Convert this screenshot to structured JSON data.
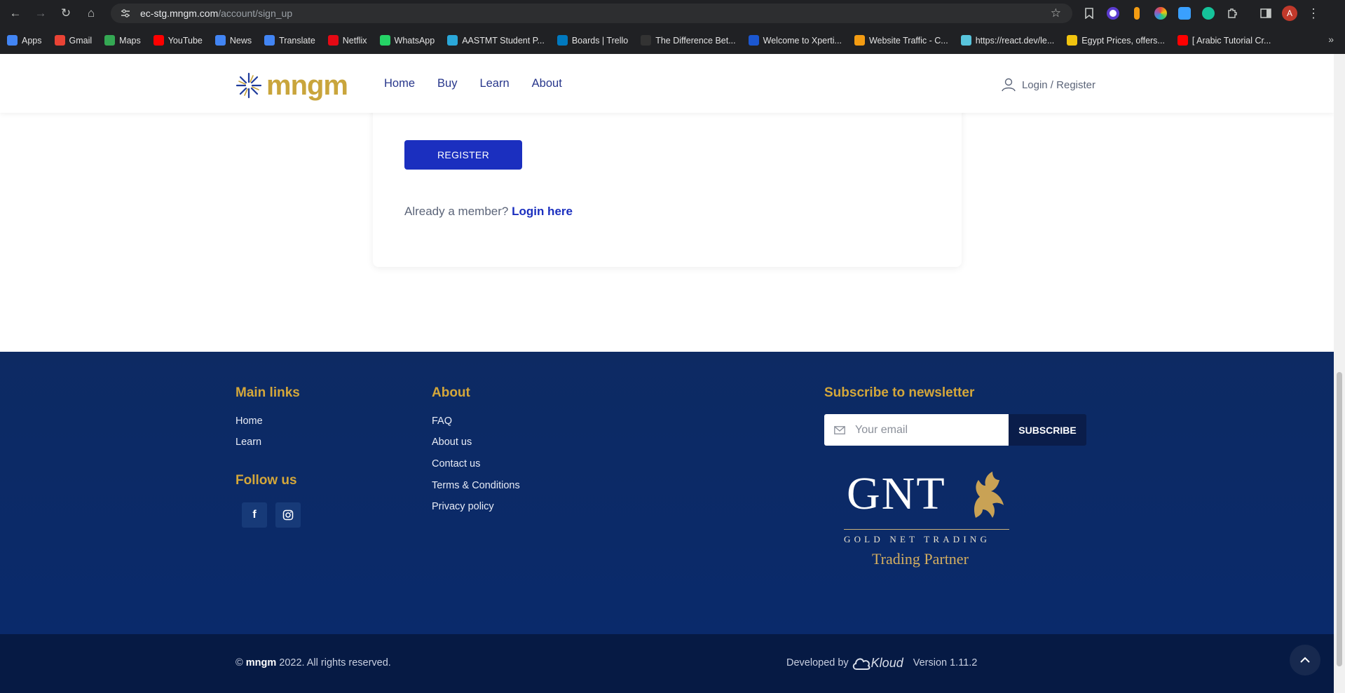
{
  "browser": {
    "url_host": "ec-stg.mngm.com",
    "url_path": "/account/sign_up",
    "profile_initial": "A",
    "bookmarks": [
      {
        "label": "Apps",
        "icon": "apps-grid-icon",
        "color": "#4285f4"
      },
      {
        "label": "Gmail",
        "icon": "gmail-icon",
        "color": "#ea4335"
      },
      {
        "label": "Maps",
        "icon": "maps-icon",
        "color": "#34a853"
      },
      {
        "label": "YouTube",
        "icon": "youtube-icon",
        "color": "#ff0000"
      },
      {
        "label": "News",
        "icon": "news-icon",
        "color": "#4285f4"
      },
      {
        "label": "Translate",
        "icon": "translate-icon",
        "color": "#4285f4"
      },
      {
        "label": "Netflix",
        "icon": "netflix-icon",
        "color": "#e50914"
      },
      {
        "label": "WhatsApp",
        "icon": "whatsapp-icon",
        "color": "#25d366"
      },
      {
        "label": "AASTMT Student P...",
        "icon": "aastmt-icon",
        "color": "#2aa7d9"
      },
      {
        "label": "Boards | Trello",
        "icon": "trello-icon",
        "color": "#0079bf"
      },
      {
        "label": "The Difference Bet...",
        "icon": "dev-icon",
        "color": "#333333"
      },
      {
        "label": "Welcome to Xperti...",
        "icon": "xperti-icon",
        "color": "#1b57d1"
      },
      {
        "label": "Website Traffic - C...",
        "icon": "traffic-icon",
        "color": "#f39c12"
      },
      {
        "label": "https://react.dev/le...",
        "icon": "react-icon",
        "color": "#58c4dc"
      },
      {
        "label": "Egypt Prices, offers...",
        "icon": "prices-icon",
        "color": "#f1c40f"
      },
      {
        "label": "[ Arabic Tutorial Cr...",
        "icon": "youtube-icon",
        "color": "#ff0000"
      }
    ]
  },
  "header": {
    "logo_text": "mngm",
    "nav": [
      "Home",
      "Buy",
      "Learn",
      "About"
    ],
    "login_label": "Login / Register"
  },
  "form": {
    "register_label": "REGISTER",
    "member_text": "Already a member?",
    "login_here": "Login here"
  },
  "footer": {
    "main_links_title": "Main links",
    "main_links": [
      "Home",
      "Learn"
    ],
    "follow_title": "Follow us",
    "about_title": "About",
    "about_links": [
      "FAQ",
      "About us",
      "Contact us",
      "Terms & Conditions",
      "Privacy policy"
    ],
    "newsletter_title": "Subscribe to newsletter",
    "email_placeholder": "Your email",
    "subscribe_label": "SUBSCRIBE",
    "gnt_big": "GNT",
    "gnt_sub": "GOLD NET TRADING",
    "gnt_partner": "Trading Partner"
  },
  "bottom": {
    "copyright_symbol": "©",
    "brand": "mngm",
    "copyright_rest": "2022. All rights reserved.",
    "developed_by": "Developed by",
    "dev_logo_text": "Kloud",
    "version": "Version 1.11.2"
  },
  "colors": {
    "brand_gold": "#c9a53c",
    "nav_blue": "#27368b",
    "button_blue": "#1b2fbf",
    "footer_navy": "#0d2a63"
  }
}
